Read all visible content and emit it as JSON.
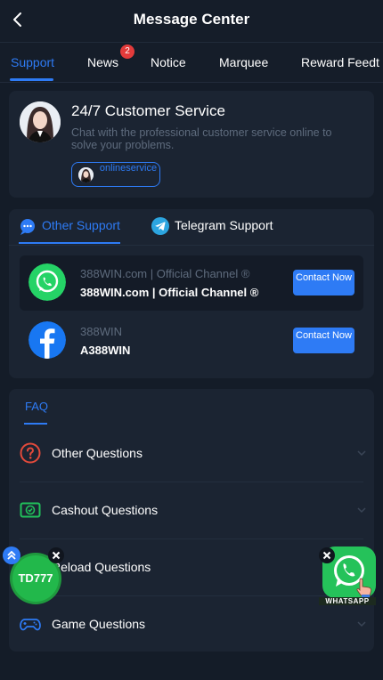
{
  "header": {
    "title": "Message Center",
    "back_icon": "chevron-left-icon"
  },
  "tabs": [
    {
      "label": "Support",
      "active": true
    },
    {
      "label": "News",
      "badge": "2"
    },
    {
      "label": "Notice"
    },
    {
      "label": "Marquee"
    },
    {
      "label": "Reward Feedt"
    }
  ],
  "customer_service": {
    "title": "24/7 Customer Service",
    "description": "Chat with the professional customer service online to solve your problems.",
    "pill_label": "onlineservice"
  },
  "support": {
    "tabs": [
      {
        "label": "Other Support",
        "icon": "chat-bubble-icon",
        "active": true
      },
      {
        "label": "Telegram Support",
        "icon": "telegram-icon"
      }
    ],
    "channels": [
      {
        "icon": "whatsapp-icon",
        "name": "388WIN.com | Official Channel ®",
        "account": "388WIN.com | Official Channel ®",
        "button": "Contact Now",
        "icon_color": "#25d366"
      },
      {
        "icon": "facebook-icon",
        "name": "388WIN",
        "account": "A388WIN",
        "button": "Contact Now",
        "icon_color": "#1877f2"
      }
    ]
  },
  "faq": {
    "tab_label": "FAQ",
    "items": [
      {
        "label": "Other Questions",
        "icon": "question-circle-icon"
      },
      {
        "label": "Cashout Questions",
        "icon": "cashout-icon"
      },
      {
        "label": "Reload Questions",
        "icon": "reload-icon"
      },
      {
        "label": "Game Questions",
        "icon": "gamepad-icon"
      }
    ]
  },
  "floating": {
    "left_label": "TD777",
    "right_label": "WHATSAPP"
  },
  "colors": {
    "accent": "#2e7bf5",
    "background": "#141c28",
    "card": "#1b2432",
    "badge": "#e23b3b"
  }
}
